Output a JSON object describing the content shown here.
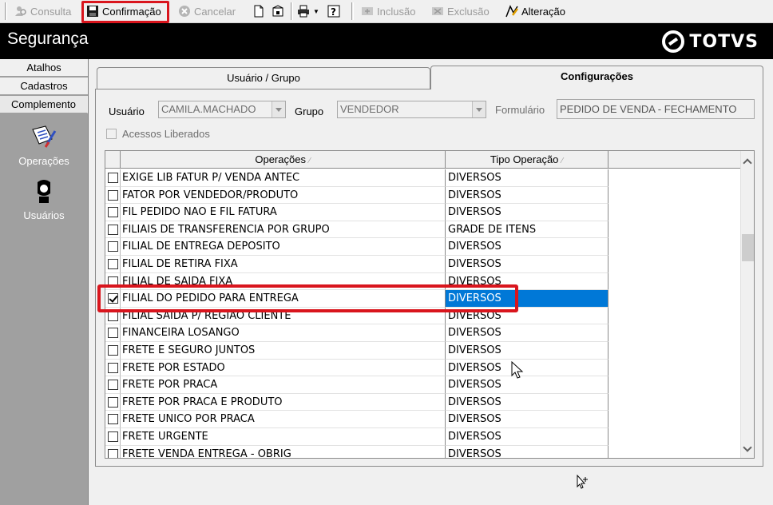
{
  "toolbar": {
    "consulta": "Consulta",
    "confirmacao": "Confirmação",
    "cancelar": "Cancelar",
    "inclusao": "Inclusão",
    "exclusao": "Exclusão",
    "alteracao": "Alteração"
  },
  "header": {
    "title": "Segurança",
    "brand": "TOTVS"
  },
  "sidebar": {
    "tabs": [
      "Atalhos",
      "Cadastros",
      "Complemento"
    ],
    "buttons": [
      "Operações",
      "Usuários"
    ]
  },
  "tabs": {
    "usuario_grupo": "Usuário  / Grupo",
    "configuracoes": "Configurações"
  },
  "filters": {
    "usuario_label": "Usuário",
    "usuario_value": "CAMILA.MACHADO",
    "grupo_label": "Grupo",
    "grupo_value": "VENDEDOR",
    "formulario_label": "Formulário",
    "formulario_value": "PEDIDO DE VENDA - FECHAMENTO",
    "acessos_label": "Acessos Liberados"
  },
  "grid": {
    "columns": [
      "Operações",
      "Tipo Operação"
    ],
    "rows": [
      {
        "op": "EXIGE LIB FATUR P/ VENDA ANTEC",
        "tipo": "DIVERSOS",
        "checked": false
      },
      {
        "op": "FATOR POR VENDEDOR/PRODUTO",
        "tipo": "DIVERSOS",
        "checked": false
      },
      {
        "op": "FIL PEDIDO NAO E FIL FATURA",
        "tipo": "DIVERSOS",
        "checked": false
      },
      {
        "op": "FILIAIS DE TRANSFERENCIA POR GRUPO",
        "tipo": "GRADE DE ITENS",
        "checked": false
      },
      {
        "op": "FILIAL DE ENTREGA DEPOSITO",
        "tipo": "DIVERSOS",
        "checked": false
      },
      {
        "op": "FILIAL DE RETIRA FIXA",
        "tipo": "DIVERSOS",
        "checked": false
      },
      {
        "op": "FILIAL DE SAIDA FIXA",
        "tipo": "DIVERSOS",
        "checked": false
      },
      {
        "op": "FILIAL DO PEDIDO PARA ENTREGA",
        "tipo": "DIVERSOS",
        "checked": true,
        "selected": true
      },
      {
        "op": "FILIAL SAIDA P/ REGIAO CLIENTE",
        "tipo": "DIVERSOS",
        "checked": false
      },
      {
        "op": "FINANCEIRA LOSANGO",
        "tipo": "DIVERSOS",
        "checked": false
      },
      {
        "op": "FRETE E SEGURO JUNTOS",
        "tipo": "DIVERSOS",
        "checked": false
      },
      {
        "op": "FRETE POR ESTADO",
        "tipo": "DIVERSOS",
        "checked": false
      },
      {
        "op": "FRETE POR PRACA",
        "tipo": "DIVERSOS",
        "checked": false
      },
      {
        "op": "FRETE POR PRACA E PRODUTO",
        "tipo": "DIVERSOS",
        "checked": false
      },
      {
        "op": "FRETE UNICO POR PRACA",
        "tipo": "DIVERSOS",
        "checked": false
      },
      {
        "op": "FRETE URGENTE",
        "tipo": "DIVERSOS",
        "checked": false
      },
      {
        "op": "FRETE VENDA ENTREGA - OBRIG",
        "tipo": "DIVERSOS",
        "checked": false
      }
    ]
  },
  "colors": {
    "highlight": "#d9151d",
    "selection": "#0078d7",
    "header_bg": "#000000",
    "sidebar_bg": "#a0a0a0"
  }
}
